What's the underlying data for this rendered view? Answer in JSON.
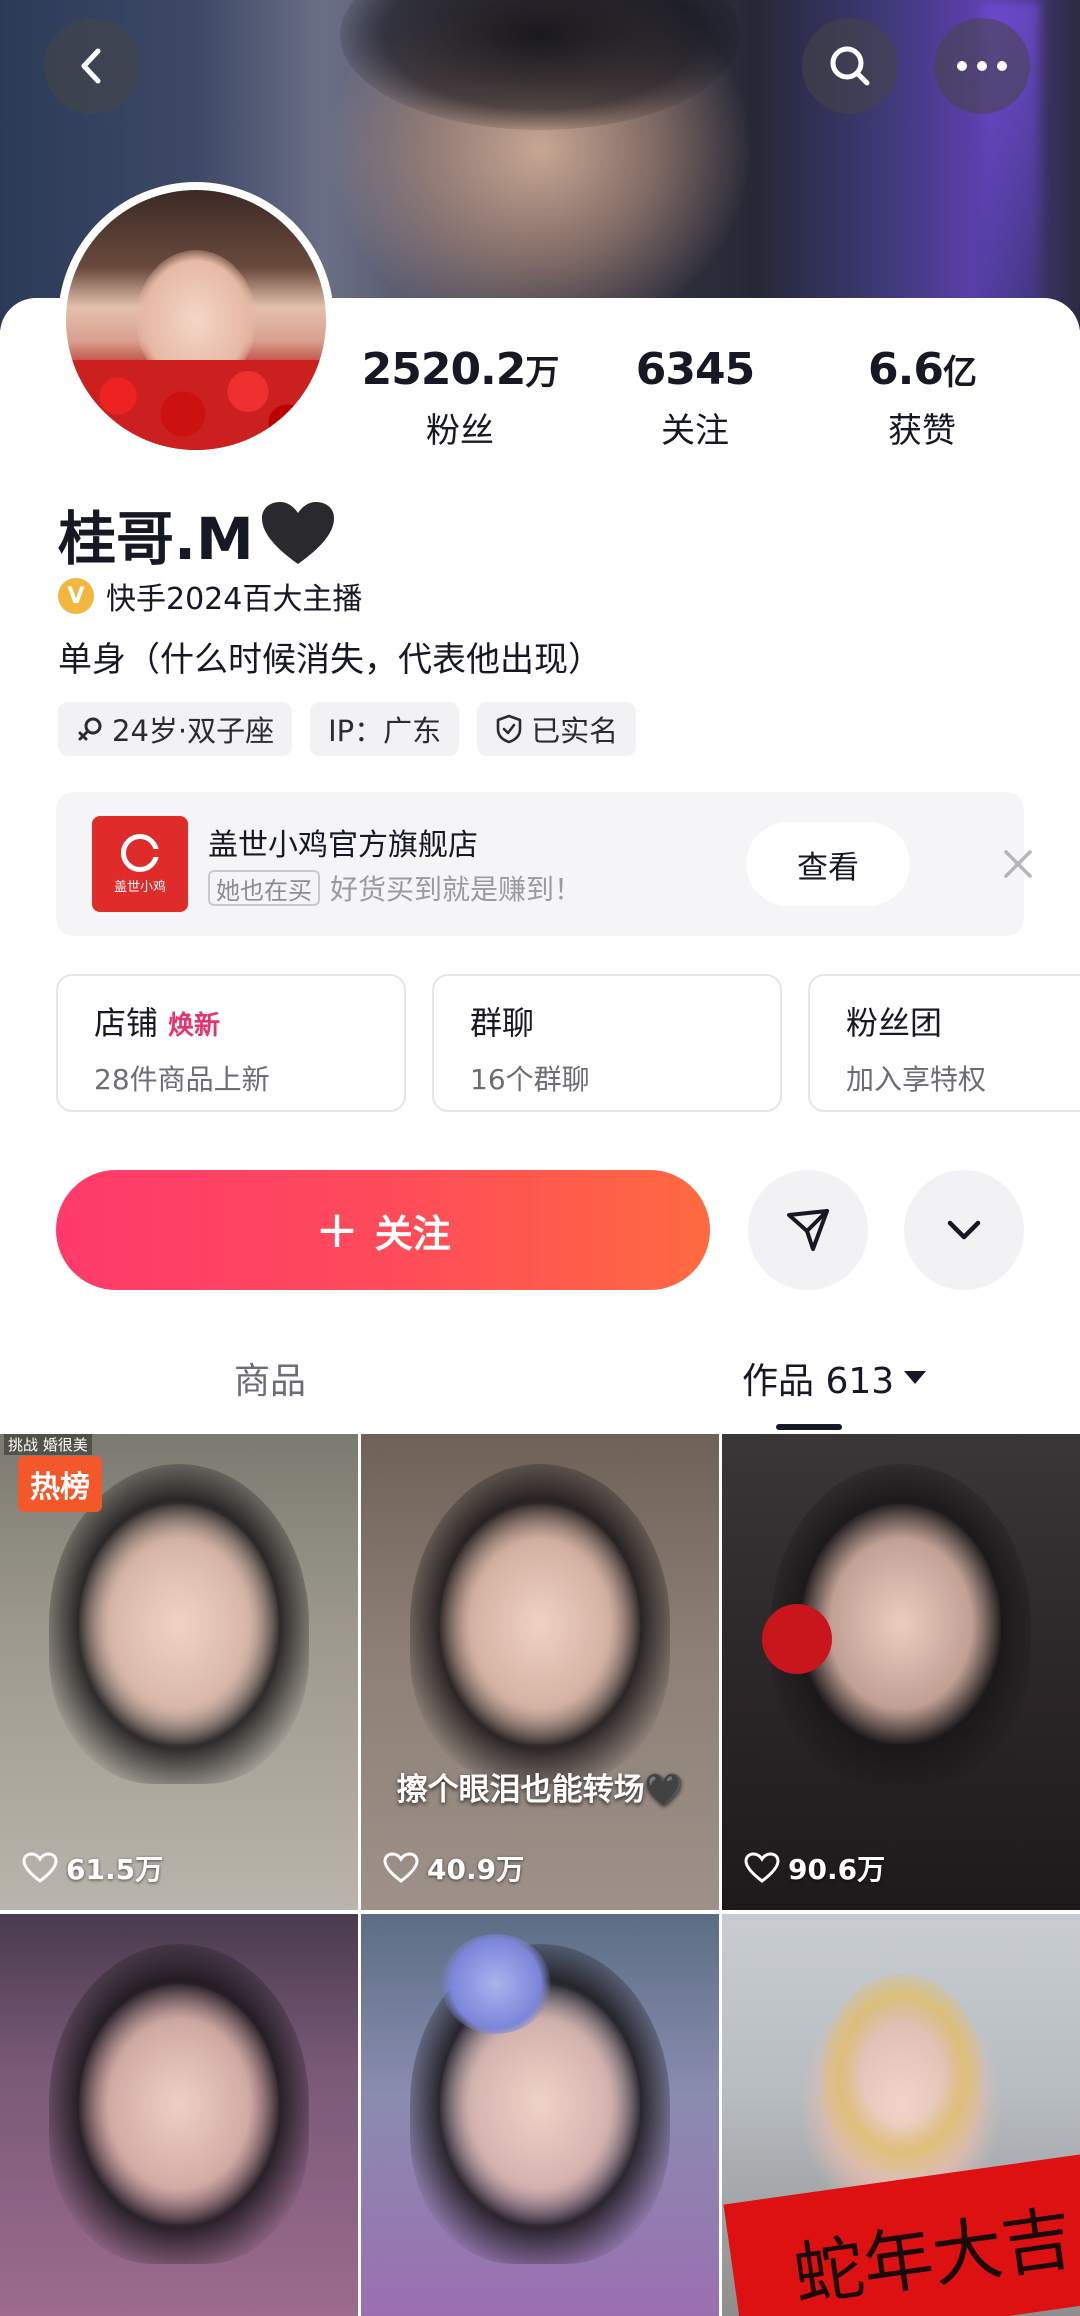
{
  "header": {
    "back_icon": "chevron-left-icon",
    "search_icon": "search-icon",
    "more_icon": "more-horizontal-icon"
  },
  "profile": {
    "stats": [
      {
        "value": "2520.2",
        "unit": "万",
        "label": "粉丝"
      },
      {
        "value": "6345",
        "unit": "",
        "label": "关注"
      },
      {
        "value": "6.6",
        "unit": "亿",
        "label": "获赞"
      }
    ],
    "nickname": "桂哥.M",
    "verified_text": "快手2024百大主播",
    "verified_badge": "V",
    "bio": "单身（什么时候消失，代表他出现）",
    "tags": [
      {
        "icon": "gender-female-icon",
        "text": "24岁·双子座"
      },
      {
        "icon": "",
        "text": "IP：广东"
      },
      {
        "icon": "shield-check-icon",
        "text": "已实名"
      }
    ]
  },
  "shop_banner": {
    "logo_text": "盖世小鸡",
    "name": "盖世小鸡官方旗舰店",
    "pill": "她也在买",
    "slogan": "好货买到就是赚到！",
    "view_label": "查看"
  },
  "entries": [
    {
      "title": "店铺",
      "hot": "焕新",
      "sub": "28件商品上新"
    },
    {
      "title": "群聊",
      "hot": "",
      "sub": "16个群聊"
    },
    {
      "title": "粉丝团",
      "hot": "",
      "sub": "加入享特权"
    }
  ],
  "actions": {
    "follow_label": "关注",
    "follow_plus": "+"
  },
  "tabs": {
    "goods": "商品",
    "works": "作品 613"
  },
  "grid": [
    {
      "likes": "61.5万",
      "hot_tag": "热榜",
      "top_text": "挑战 婚很美",
      "caption": ""
    },
    {
      "likes": "40.9万",
      "hot_tag": "",
      "top_text": "",
      "caption": "擦个眼泪也能转场🖤"
    },
    {
      "likes": "90.6万",
      "hot_tag": "",
      "top_text": "",
      "caption": ""
    },
    {
      "likes": "",
      "hot_tag": "",
      "top_text": "",
      "caption": ""
    },
    {
      "likes": "",
      "hot_tag": "",
      "top_text": "",
      "caption": ""
    },
    {
      "likes": "",
      "hot_tag": "",
      "top_text": "",
      "caption": "",
      "banner_text": "蛇年大吉"
    }
  ],
  "colors": {
    "follow_start": "#fe3a6b",
    "follow_end": "#fe6a40",
    "hot_pink": "#e8336d",
    "verified_gold": "#f3b73f",
    "hot_tag_orange": "#f2582a"
  }
}
